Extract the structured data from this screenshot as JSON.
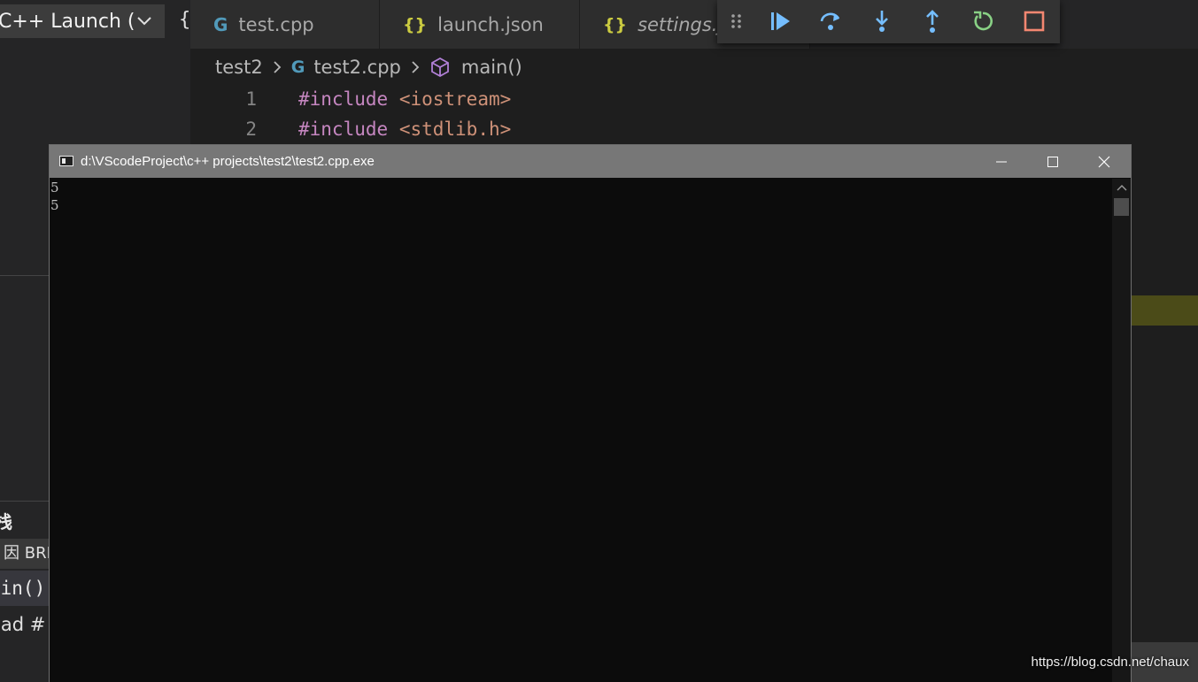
{
  "sidebar": {
    "launch_config": "C++ Launch (",
    "call_stack_title": "栈",
    "paused_reason": "因 BRE",
    "frame_main": "ain()",
    "thread_label": "ead #"
  },
  "tabs": [
    {
      "label": "test.cpp",
      "icon": "cpp-icon"
    },
    {
      "label": "launch.json",
      "icon": "json-icon"
    },
    {
      "label": "settings.js",
      "icon": "json-icon"
    }
  ],
  "breadcrumb": {
    "folder": "test2",
    "file": "test2.cpp",
    "symbol": "main()"
  },
  "code_lines": [
    {
      "num": "1",
      "keyword": "#include",
      "arg": "<iostream>"
    },
    {
      "num": "2",
      "keyword": "#include",
      "arg": "<stdlib.h>"
    }
  ],
  "console": {
    "title": "d:\\VScodeProject\\c++ projects\\test2\\test2.cpp.exe",
    "output": [
      "5",
      "5"
    ]
  },
  "debug_toolbar": [
    "continue-icon",
    "step-over-icon",
    "step-into-icon",
    "step-out-icon",
    "restart-icon",
    "stop-icon"
  ],
  "colors": {
    "continue": "#75beff",
    "restart": "#89d185",
    "stop": "#f48771"
  },
  "watermark": "https://blog.csdn.net/chaux"
}
